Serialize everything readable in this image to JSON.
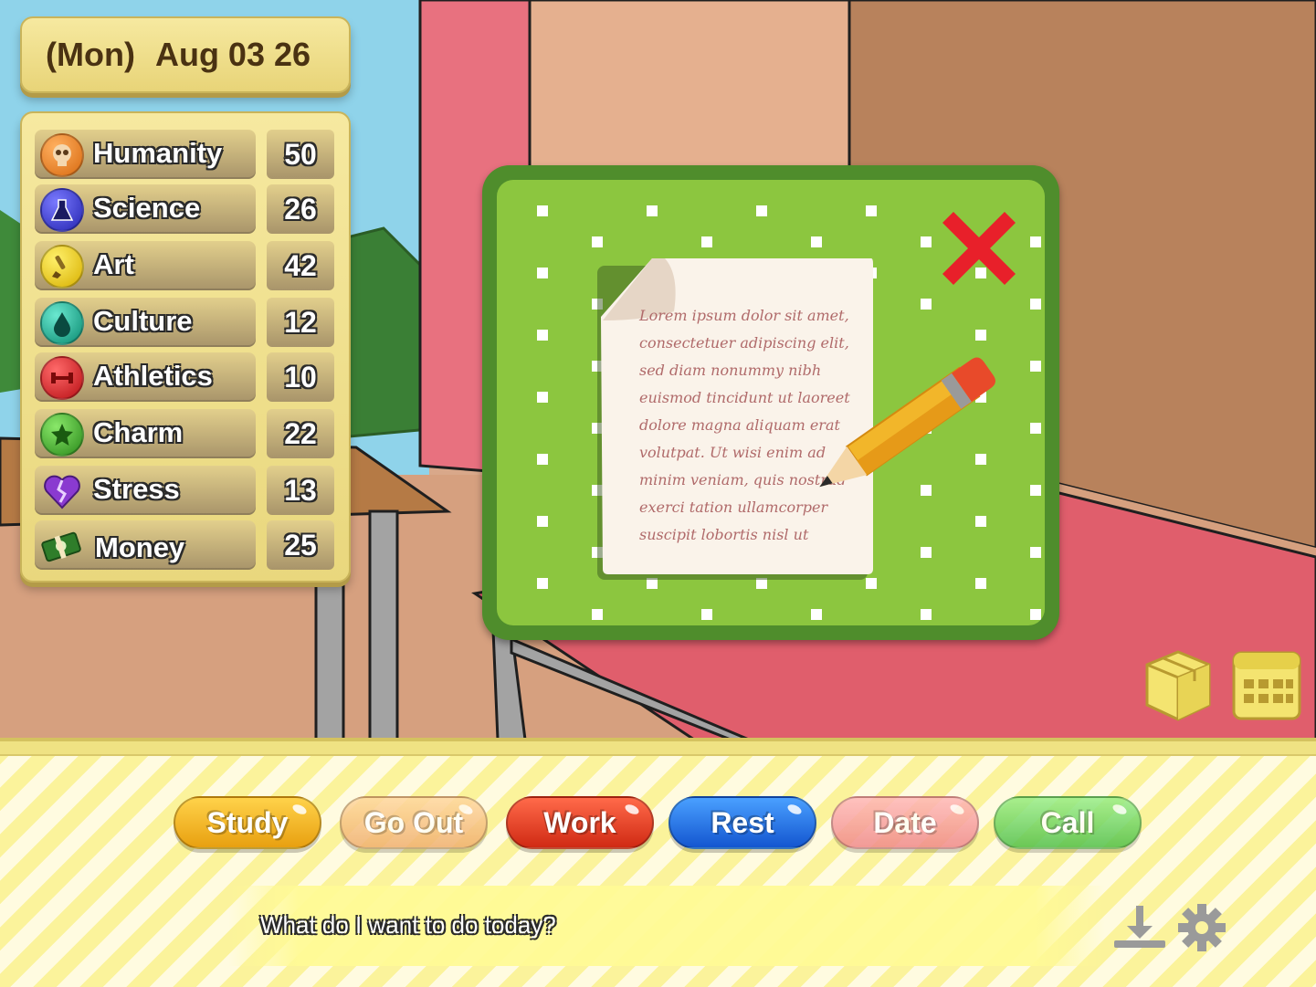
{
  "date": {
    "weekday": "(Mon)",
    "date": "Aug 03 26"
  },
  "stats": [
    {
      "label": "Humanity",
      "value": "50",
      "icon": "skull-icon",
      "color": "#e07a1e"
    },
    {
      "label": "Science",
      "value": "26",
      "icon": "flask-icon",
      "color": "#3a3ad0"
    },
    {
      "label": "Art",
      "value": "42",
      "icon": "brush-icon",
      "color": "#e8c400"
    },
    {
      "label": "Culture",
      "value": "12",
      "icon": "drop-icon",
      "color": "#1aa890"
    },
    {
      "label": "Athletics",
      "value": "10",
      "icon": "dumbbell-icon",
      "color": "#d8262a"
    },
    {
      "label": "Charm",
      "value": "22",
      "icon": "star-icon",
      "color": "#3ea832"
    },
    {
      "label": "Stress",
      "value": "13",
      "icon": "broken-heart-icon",
      "color": "#8a3ad0"
    },
    {
      "label": "Money",
      "value": "25",
      "icon": "cash-icon",
      "color": "#2f7d2a"
    }
  ],
  "memo": {
    "lines": [
      "Lorem ipsum dolor sit amet,",
      "consectetuer adipiscing elit,",
      "sed diam nonummy nibh",
      "euismod tincidunt ut laoreet",
      "dolore magna aliquam erat",
      "volutpat. Ut wisi enim ad",
      "minim veniam, quis nostrud",
      "exerci tation ullamcorper",
      "suscipit lobortis nisl ut"
    ]
  },
  "actions": [
    {
      "label": "Study",
      "color": "#f2b418"
    },
    {
      "label": "Go Out",
      "color": "#f5c27a"
    },
    {
      "label": "Work",
      "color": "#e23a22"
    },
    {
      "label": "Rest",
      "color": "#1e6fe0"
    },
    {
      "label": "Date",
      "color": "#f59a9a"
    },
    {
      "label": "Call",
      "color": "#6cd06a"
    }
  ],
  "message": "What do I want to do today?"
}
